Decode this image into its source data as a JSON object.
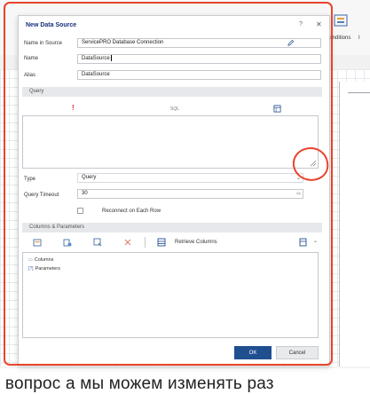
{
  "background": {
    "ribbon_label": "Conditions",
    "cut_label": "I"
  },
  "dialog": {
    "title": "New Data Source",
    "help_glyph": "?",
    "close_glyph": "✕",
    "fields": {
      "name_in_source": {
        "label": "Name in Source",
        "value": "ServicePRO Database Connection"
      },
      "name": {
        "label": "Name",
        "value": "DataSource"
      },
      "alias": {
        "label": "Alias",
        "value": "DataSource"
      },
      "type": {
        "label": "Type",
        "value": "Query"
      },
      "query_timeout": {
        "label": "Query Timeout",
        "value": "30"
      }
    },
    "query_section": {
      "title": "Query",
      "alert_glyph": "!",
      "sql_label": "SQL"
    },
    "reconnect_checkbox": {
      "label": "Reconnect on Each Row",
      "checked": false
    },
    "columns_section": {
      "title": "Columns & Parameters",
      "retrieve_label": "Retrieve Columns",
      "tree_items": [
        {
          "icon": "▭",
          "label": "Columns"
        },
        {
          "icon": "[?]",
          "label": "Parameters"
        }
      ]
    },
    "buttons": {
      "ok": "OK",
      "cancel": "Cancel"
    }
  },
  "caption": "і вопрос а мы можем изменять раз",
  "colors": {
    "accent": "#1f4f8f",
    "title": "#16307c",
    "annotation": "#e8442c",
    "alert": "#e03020"
  }
}
